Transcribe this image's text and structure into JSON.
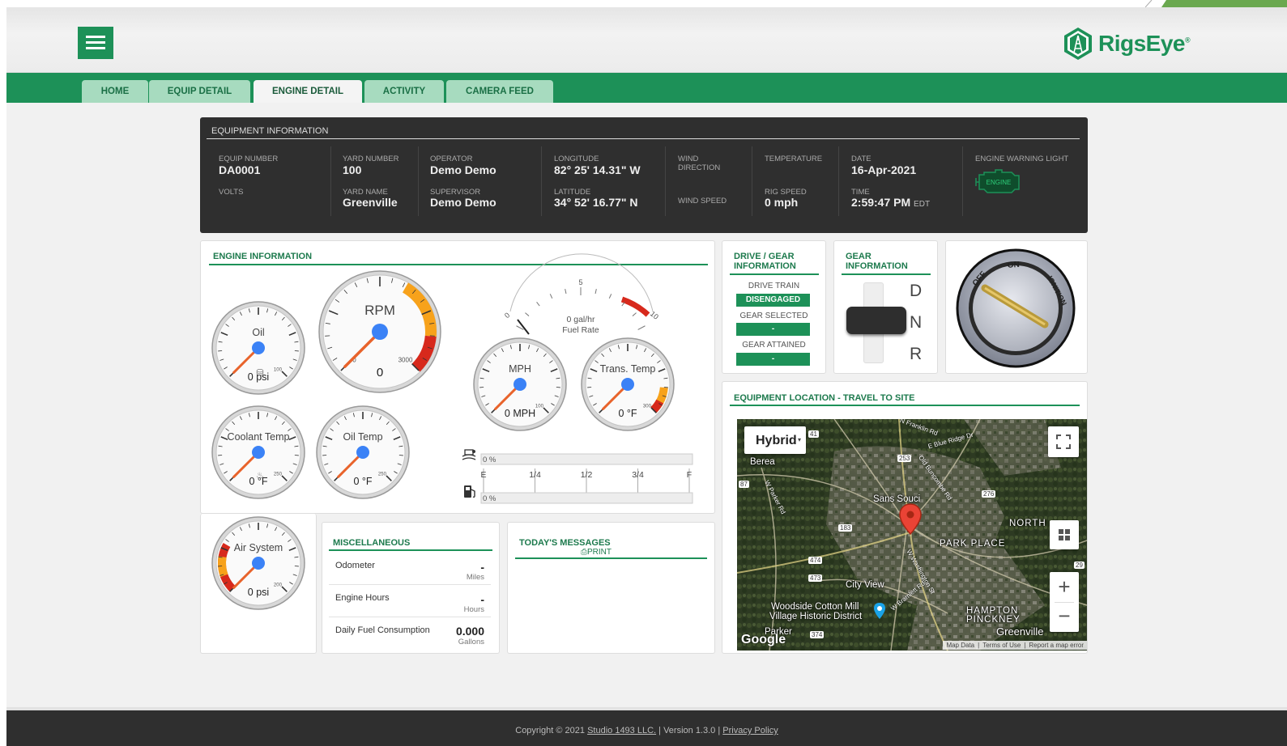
{
  "app": {
    "logo_text": "RigsEye",
    "logo_mark": "®"
  },
  "nav": {
    "tabs": [
      "HOME",
      "EQUIP DETAIL",
      "ENGINE DETAIL",
      "ACTIVITY",
      "CAMERA FEED"
    ],
    "active": "ENGINE DETAIL"
  },
  "equipment": {
    "title": "EQUIPMENT INFORMATION",
    "equip_number_label": "EQUIP NUMBER",
    "equip_number": "DA0001",
    "volts_label": "VOLTS",
    "yard_number_label": "YARD NUMBER",
    "yard_number": "100",
    "yard_name_label": "YARD NAME",
    "yard_name": "Greenville",
    "operator_label": "OPERATOR",
    "operator": "Demo Demo",
    "supervisor_label": "SUPERVISOR",
    "supervisor": "Demo Demo",
    "longitude_label": "LONGITUDE",
    "longitude": "82° 25' 14.31\" W",
    "latitude_label": "LATITUDE",
    "latitude": "34° 52' 16.77\" N",
    "wind_direction_label": "WIND DIRECTION",
    "wind_speed_label": "WIND SPEED",
    "temperature_label": "TEMPERATURE",
    "rig_speed_label": "RIG SPEED",
    "rig_speed": "0 mph",
    "date_label": "DATE",
    "date": "16-Apr-2021",
    "time_label": "TIME",
    "time": "2:59:47 PM",
    "time_zone": "EDT",
    "warning_label": "ENGINE WARNING LIGHT",
    "warning_icon_text": "ENGINE"
  },
  "engine": {
    "title": "ENGINE INFORMATION",
    "gauges": {
      "oil": {
        "name": "Oil",
        "reading": "0 psi",
        "max_label": "100",
        "value": 0
      },
      "rpm": {
        "name": "RPM",
        "reading": "0",
        "min_label": "0",
        "max_label": "3000",
        "value": 0
      },
      "coolant": {
        "name": "Coolant Temp",
        "reading": "0 °F",
        "max_label": "250",
        "value": 0
      },
      "oiltemp": {
        "name": "Oil Temp",
        "reading": "0 °F",
        "max_label": "250",
        "value": 0
      },
      "mph": {
        "name": "MPH",
        "reading": "0 MPH",
        "max_label": "100",
        "value": 0
      },
      "trans": {
        "name": "Trans. Temp",
        "reading": "0 °F",
        "max_label": "300",
        "value": 0
      },
      "air": {
        "name": "Air System",
        "reading": "0 psi",
        "max_label": "200",
        "value": 0
      }
    },
    "fuel_rate": {
      "reading": "0 gal/hr",
      "label": "Fuel Rate",
      "min_label": "0",
      "mid_label": "5",
      "max_label": "10",
      "value": 0
    },
    "def_level": {
      "reading": "0 %",
      "value": 0
    },
    "fuel_level": {
      "reading": "0 %",
      "value": 0
    },
    "fuel_scale": [
      "E",
      "1/4",
      "1/2",
      "3/4",
      "F"
    ]
  },
  "drive": {
    "title": "DRIVE / GEAR INFORMATION",
    "drive_train_label": "DRIVE TRAIN",
    "drive_train": "DISENGAGED",
    "gear_selected_label": "GEAR SELECTED",
    "gear_selected": "-",
    "gear_attained_label": "GEAR ATTAINED",
    "gear_attained": "-"
  },
  "gear": {
    "title": "GEAR INFORMATION",
    "positions": [
      "D",
      "N",
      "R"
    ],
    "current": "N"
  },
  "ignition": {
    "off_label": "OFF",
    "on_label": "ON",
    "ignition_label": "IGNITION",
    "state": "OFF"
  },
  "location": {
    "title": "EQUIPMENT LOCATION - TRAVEL TO SITE",
    "map_type": "Hybrid",
    "places": [
      "Berea",
      "Sans Souci",
      "NORTH",
      "PARK PLACE",
      "City View",
      "Woodside Cotton Mill",
      "Village Historic District",
      "HAMPTON",
      "PINCKNEY",
      "Greenville",
      "Parker"
    ],
    "roads": [
      "N Franklin Rd",
      "E Blue Ridge Dr",
      "253",
      "Old Buncombe Rd",
      "276",
      "87",
      "183",
      "474",
      "473",
      "W Parker Rd",
      "W Washington St",
      "374",
      "29",
      "41",
      "W Bramlett Rd"
    ],
    "google_label": "Google",
    "attribution": [
      "Map Data",
      "Terms of Use",
      "Report a map error"
    ]
  },
  "misc": {
    "title": "MISCELLANEOUS",
    "rows": [
      {
        "name": "Odometer",
        "value": "-",
        "unit": "Miles"
      },
      {
        "name": "Engine Hours",
        "value": "-",
        "unit": "Hours"
      },
      {
        "name": "Daily Fuel Consumption",
        "value": "0.000",
        "unit": "Gallons"
      }
    ]
  },
  "messages": {
    "title": "TODAY'S MESSAGES",
    "print_label": "PRINT"
  },
  "footer": {
    "copyright": "Copyright © 2021",
    "company": "Studio 1493 LLC.",
    "version": "| Version 1.3.0 |",
    "privacy": "Privacy Policy"
  },
  "colors": {
    "brand_green": "#1d9158",
    "dark_panel": "#2f2f2f",
    "needle": "#e8632b",
    "hub": "#3b82f6",
    "zone_orange": "#f7a21b",
    "zone_red": "#d7291c"
  }
}
